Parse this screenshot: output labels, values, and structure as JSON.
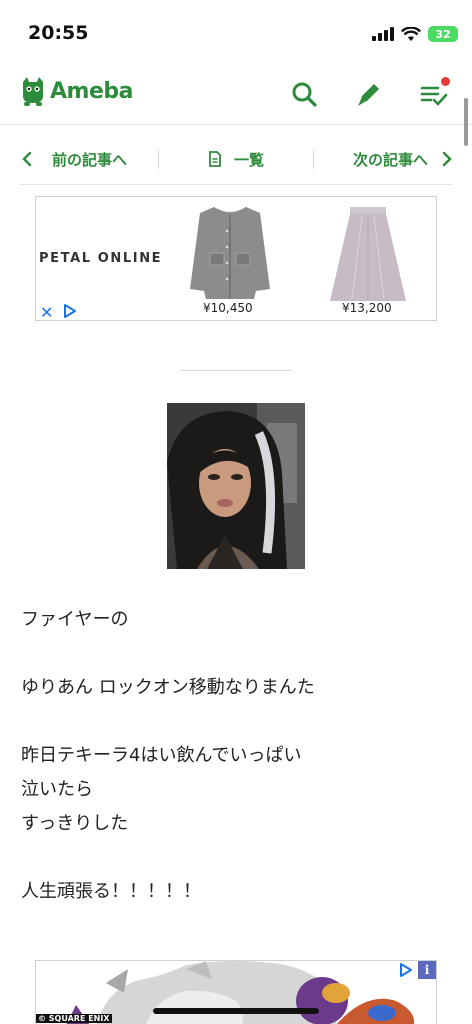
{
  "status": {
    "time": "20:55",
    "battery": "32"
  },
  "header": {
    "logo": "Ameba",
    "icons": [
      "search-icon",
      "pencil-icon",
      "checklist-icon"
    ]
  },
  "nav": {
    "prev": "前の記事へ",
    "list": "一覧",
    "next": "次の記事へ"
  },
  "ad_top": {
    "brand": "PETAL ONLINE",
    "prices": [
      "¥10,450",
      "¥13,200"
    ]
  },
  "article": {
    "lines": [
      "ファイヤーの",
      "ゆりあん ロックオン移動なりまんた",
      "昨日テキーラ4はい飲んでいっぱい",
      "泣いたら",
      "すっきりした",
      "人生頑張る！！！！！"
    ]
  },
  "ad_bottom": {
    "copyright": "© SQUARE ENIX",
    "info": "i"
  },
  "colors": {
    "accent": "#2d8c3c",
    "ad_icon": "#1a73e8",
    "notify": "#e53935"
  }
}
